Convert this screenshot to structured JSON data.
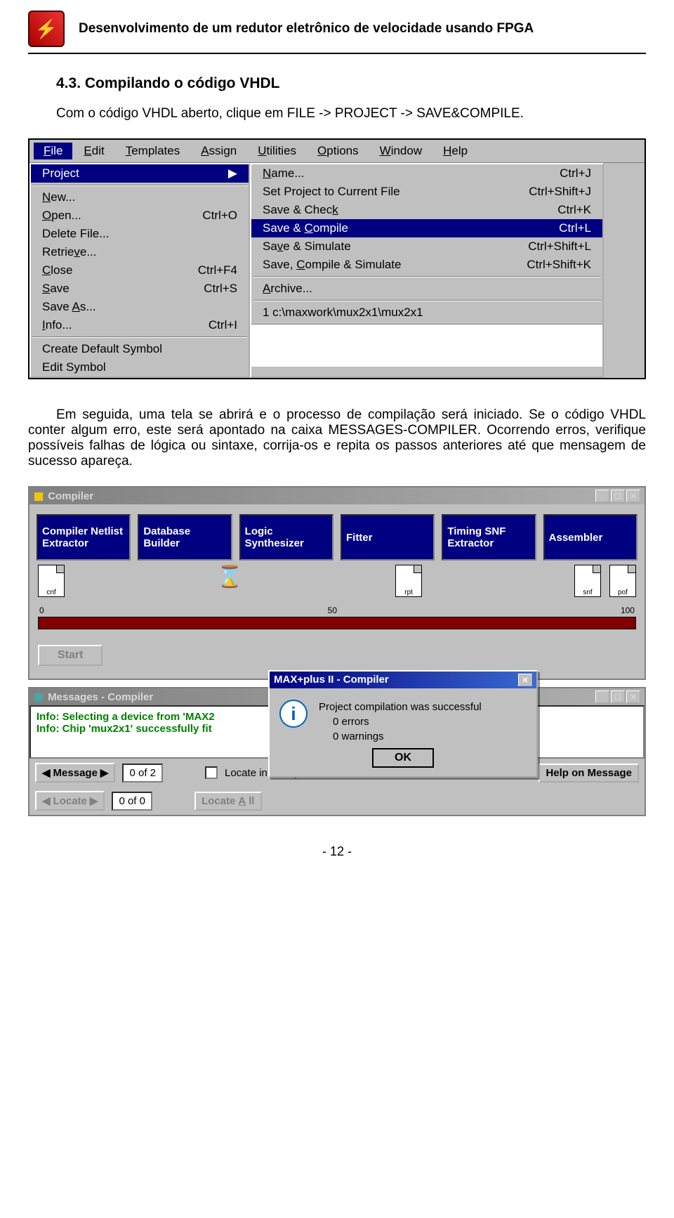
{
  "header": {
    "title": "Desenvolvimento de um redutor eletrônico de velocidade usando FPGA"
  },
  "section": {
    "title": "4.3. Compilando o código VHDL",
    "p1": "Com o código VHDL aberto, clique em FILE -> PROJECT -> SAVE&COMPILE.",
    "p2": "Em seguida, uma tela se abrirá e o processo de compilação será iniciado. Se o código VHDL conter algum erro, este será apontado na caixa MESSAGES-COMPILER. Ocorrendo erros, verifique possíveis falhas de lógica ou sintaxe, corrija-os e repita os passos anteriores até que mensagem de sucesso apareça."
  },
  "menubar": [
    "File",
    "Edit",
    "Templates",
    "Assign",
    "Utilities",
    "Options",
    "Window",
    "Help"
  ],
  "file_menu": {
    "project": "Project",
    "items_left": [
      {
        "label": "New...",
        "sc": ""
      },
      {
        "label": "Open...",
        "sc": "Ctrl+O"
      },
      {
        "label": "Delete File...",
        "sc": ""
      },
      {
        "label": "Retrieve...",
        "sc": ""
      },
      {
        "label": "Close",
        "sc": "Ctrl+F4"
      },
      {
        "label": "Save",
        "sc": "Ctrl+S"
      },
      {
        "label": "Save As...",
        "sc": ""
      },
      {
        "label": "Info...",
        "sc": "Ctrl+I"
      }
    ],
    "left_tail": [
      "Create Default Symbol",
      "Edit Symbol"
    ],
    "items_right": [
      {
        "label": "Name...",
        "sc": "Ctrl+J"
      },
      {
        "label": "Set Project to Current File",
        "sc": "Ctrl+Shift+J"
      },
      {
        "label": "Save & Check",
        "sc": "Ctrl+K"
      },
      {
        "label": "Save & Compile",
        "sc": "Ctrl+L",
        "hl": true
      },
      {
        "label": "Save & Simulate",
        "sc": "Ctrl+Shift+L"
      },
      {
        "label": "Save, Compile & Simulate",
        "sc": "Ctrl+Shift+K"
      }
    ],
    "archive": "Archive...",
    "recent": "1  c:\\maxwork\\mux2x1\\mux2x1"
  },
  "compiler": {
    "title": "Compiler",
    "stages": [
      "Compiler Netlist Extractor",
      "Database Builder",
      "Logic Synthesizer",
      "Fitter",
      "Timing SNF Extractor",
      "Assembler"
    ],
    "ext": [
      "cnf",
      "",
      "rpt",
      "",
      "snf",
      "pof"
    ],
    "scale": [
      "0",
      "50",
      "100"
    ],
    "start": "Start"
  },
  "popup": {
    "title": "MAX+plus II - Compiler",
    "l1": "Project compilation was successful",
    "l2": "0 errors",
    "l3": "0 warnings",
    "ok": "OK"
  },
  "messages": {
    "title": "Messages - Compiler",
    "l1": "Info: Selecting a device from 'MAX2",
    "l2": "Info: Chip 'mux2x1' successfully fit",
    "msg_btn": "Message",
    "msg_count": "0 of 2",
    "locate_chk": "Locate in Floorplan Editor",
    "help_btn": "Help on Message",
    "locate_btn": "Locate",
    "locate_count": "0 of 0",
    "locate_all": "Locate All"
  },
  "footer": "- 12 -"
}
